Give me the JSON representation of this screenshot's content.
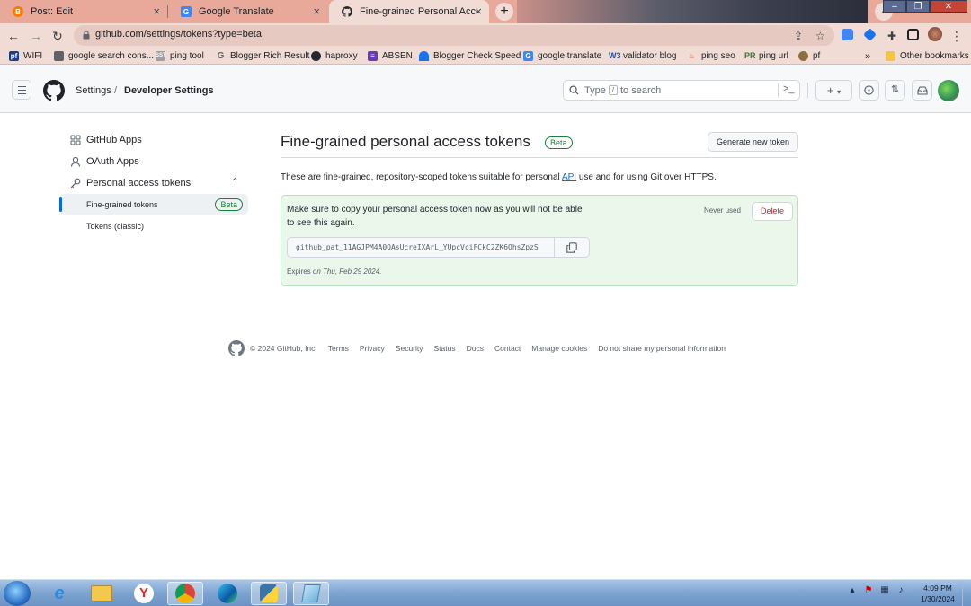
{
  "browser": {
    "tabs": [
      {
        "title": "Post: Edit",
        "favicon": "blogger-icon",
        "color": "#f57d00"
      },
      {
        "title": "Google Translate",
        "favicon": "google-translate-icon",
        "color": "#4285f4"
      },
      {
        "title": "Fine-grained Personal Access Tok",
        "favicon": "github-icon",
        "color": "#24292f"
      }
    ],
    "new_tab_label": "+",
    "url": "github.com/settings/tokens?type=beta",
    "bookmarks": [
      {
        "label": "WIFI",
        "icon": "pf-icon",
        "color": "#1a3d8f"
      },
      {
        "label": "google search cons...",
        "icon": "search-console-icon",
        "color": "#5f6368"
      },
      {
        "label": "ping tool",
        "icon": "seo-icon",
        "color": "#9aa0a6"
      },
      {
        "label": "Blogger Rich Result",
        "icon": "google-icon",
        "color": "#5f6368"
      },
      {
        "label": "haproxy",
        "icon": "github-icon",
        "color": "#24292f"
      },
      {
        "label": "ABSEN",
        "icon": "form-icon",
        "color": "#673ab7"
      },
      {
        "label": "Blogger Check Speed",
        "icon": "speed-icon",
        "color": "#1a73e8"
      },
      {
        "label": "google translate",
        "icon": "google-translate-icon",
        "color": "#4285f4"
      },
      {
        "label": "validator blog",
        "icon": "w3c-icon",
        "color": "#1d4f91"
      },
      {
        "label": "ping seo",
        "icon": "ping-icon",
        "color": "#e8453c"
      },
      {
        "label": "ping url",
        "icon": "pr-icon",
        "color": "#2e7d32"
      },
      {
        "label": "pf",
        "icon": "pf-round-icon",
        "color": "#8d6e3f"
      }
    ],
    "overflow_label": "»",
    "other_bookmarks_label": "Other bookmarks"
  },
  "header": {
    "breadcrumb_settings": "Settings",
    "breadcrumb_separator": "/",
    "breadcrumb_developer": "Developer Settings",
    "search_prefix": "Type",
    "search_key": "/",
    "search_suffix": "to search",
    "create_label": "+"
  },
  "sidebar": {
    "items": [
      {
        "label": "GitHub Apps",
        "icon": "apps-grid-icon"
      },
      {
        "label": "OAuth Apps",
        "icon": "person-icon"
      },
      {
        "label": "Personal access tokens",
        "icon": "key-icon"
      }
    ],
    "sub_items": [
      {
        "label": "Fine-grained tokens",
        "badge": "Beta"
      },
      {
        "label": "Tokens (classic)"
      }
    ]
  },
  "main": {
    "title": "Fine-grained personal access tokens",
    "title_badge": "Beta",
    "generate_button": "Generate new token",
    "description_before": "These are fine-grained, repository-scoped tokens suitable for personal",
    "description_link": "API",
    "description_after": "use and for using Git over HTTPS.",
    "flash": {
      "message": "Make sure to copy your personal access token now as you will not be able to see this again.",
      "status": "Never used",
      "delete_button": "Delete",
      "token_value": "github_pat_11AGJPM4A0QAsUcreIXArL_YUpcVciFCkC2ZK6OhsZpzS",
      "expires_prefix": "Expires",
      "expires_date": "on Thu, Feb 29 2024."
    }
  },
  "footer": {
    "copyright": "© 2024 GitHub, Inc.",
    "links": [
      "Terms",
      "Privacy",
      "Security",
      "Status",
      "Docs",
      "Contact",
      "Manage cookies",
      "Do not share my personal information"
    ]
  },
  "taskbar": {
    "apps": [
      "internet-explorer-icon",
      "file-explorer-icon",
      "yandex-icon",
      "chrome-icon",
      "edge-icon",
      "python-icon",
      "notepad-icon"
    ],
    "time": "4:09 PM",
    "date": "1/30/2024"
  }
}
